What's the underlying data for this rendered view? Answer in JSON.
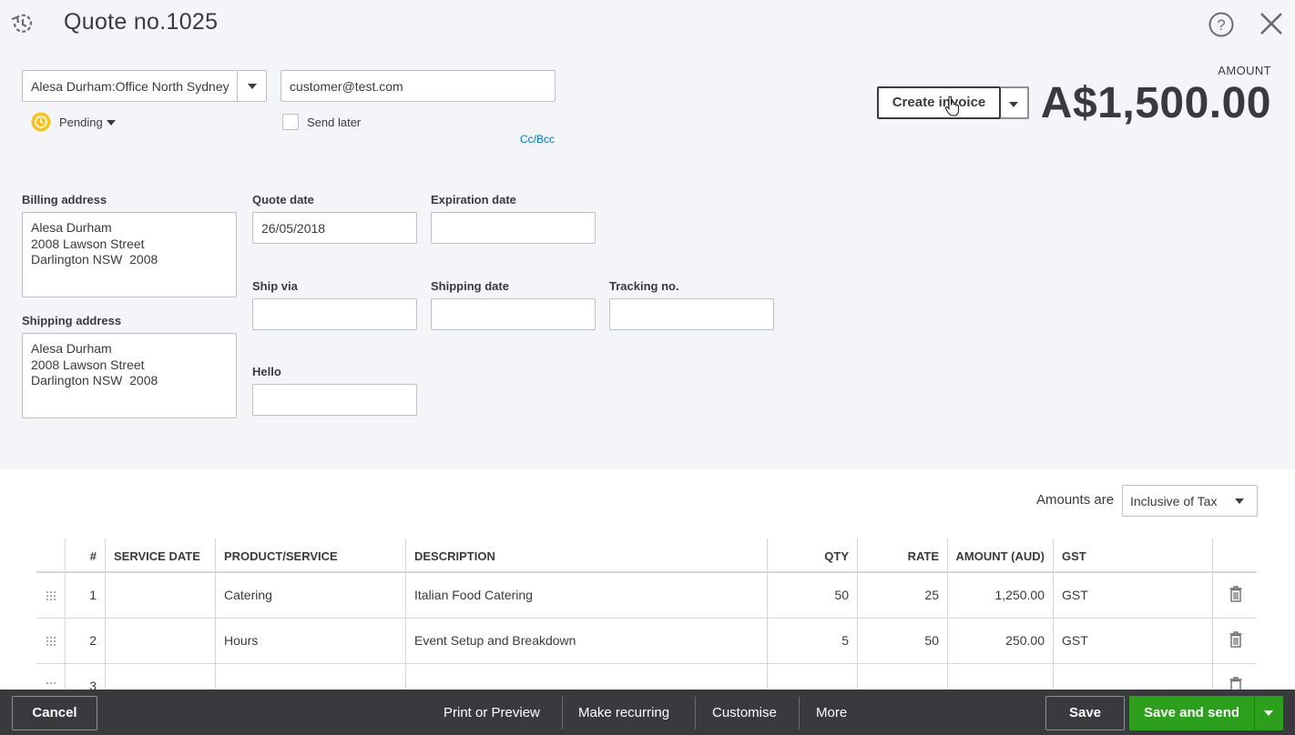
{
  "header": {
    "title": "Quote no.1025",
    "history_icon": "recent-history-icon",
    "help_icon": "help-icon",
    "close_icon": "close-icon"
  },
  "customer": {
    "name": "Alesa Durham:Office North Sydney",
    "email": "customer@test.com",
    "status": "Pending",
    "send_later_label": "Send later",
    "send_later_checked": false,
    "cc_bcc": "Cc/Bcc"
  },
  "amount": {
    "label": "AMOUNT",
    "value": "A$1,500.00"
  },
  "create_invoice": {
    "label": "Create invoice"
  },
  "billing": {
    "label": "Billing address",
    "lines": [
      "Alesa Durham",
      "2008 Lawson Street",
      "Darlington NSW  2008"
    ]
  },
  "shipping": {
    "label": "Shipping address",
    "lines": [
      "Alesa Durham",
      "2008 Lawson Street",
      "Darlington NSW  2008"
    ]
  },
  "fields": {
    "quote_date_label": "Quote date",
    "quote_date": "26/05/2018",
    "expiration_date_label": "Expiration date",
    "expiration_date": "",
    "ship_via_label": "Ship via",
    "ship_via": "",
    "shipping_date_label": "Shipping date",
    "shipping_date": "",
    "tracking_label": "Tracking no.",
    "tracking": "",
    "hello_label": "Hello",
    "hello": ""
  },
  "tax": {
    "label": "Amounts are",
    "value": "Inclusive of Tax"
  },
  "table": {
    "headers": {
      "num": "#",
      "service_date": "SERVICE DATE",
      "product": "PRODUCT/SERVICE",
      "description": "DESCRIPTION",
      "qty": "QTY",
      "rate": "RATE",
      "amount": "AMOUNT (AUD)",
      "gst": "GST"
    },
    "rows": [
      {
        "num": "1",
        "service_date": "",
        "product": "Catering",
        "description": "Italian Food Catering",
        "qty": "50",
        "rate": "25",
        "amount": "1,250.00",
        "gst": "GST"
      },
      {
        "num": "2",
        "service_date": "",
        "product": "Hours",
        "description": "Event Setup and Breakdown",
        "qty": "5",
        "rate": "50",
        "amount": "250.00",
        "gst": "GST"
      },
      {
        "num": "3",
        "service_date": "",
        "product": "",
        "description": "",
        "qty": "",
        "rate": "",
        "amount": "",
        "gst": ""
      }
    ]
  },
  "footer": {
    "cancel": "Cancel",
    "print_preview": "Print or Preview",
    "make_recurring": "Make recurring",
    "customise": "Customise",
    "more": "More",
    "save": "Save",
    "save_and_send": "Save and send"
  },
  "colors": {
    "primary_green": "#2ca01c",
    "link_blue": "#0077c5",
    "footer_bg": "#393a3d",
    "panel_bg": "#f4f5f8",
    "pending_yellow": "#f7c21b"
  }
}
